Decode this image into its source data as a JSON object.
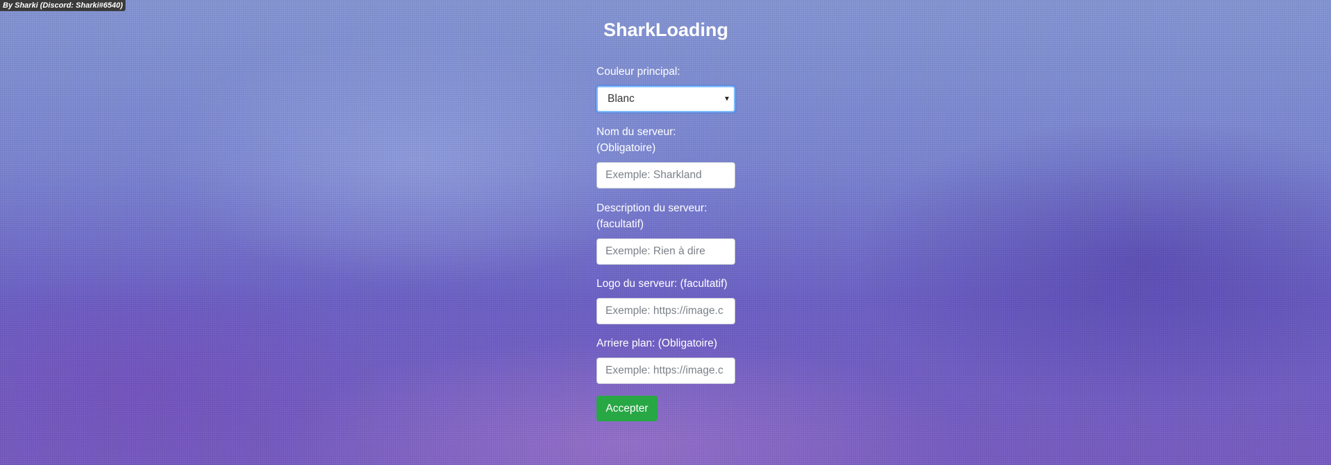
{
  "credit": "By Sharki (Discord: Sharki#6540)",
  "title": "SharkLoading",
  "form": {
    "couleur_label": "Couleur principal:",
    "couleur_value": "Blanc",
    "nom_label_line1": "Nom du serveur:",
    "nom_label_line2": "(Obligatoire)",
    "nom_placeholder": "Exemple: Sharkland",
    "description_label_line1": "Description du serveur:",
    "description_label_line2": "(facultatif)",
    "description_placeholder": "Exemple: Rien à dire",
    "logo_label": "Logo du serveur: (facultatif)",
    "logo_placeholder": "Exemple: https://image.c",
    "background_label": "Arriere plan: (Obligatoire)",
    "background_placeholder": "Exemple: https://image.c",
    "submit_label": "Accepter"
  },
  "colors": {
    "accent_button": "#28a745",
    "focus_border": "#80bdff"
  },
  "icons": {
    "select_arrow": "caret-down-icon"
  }
}
